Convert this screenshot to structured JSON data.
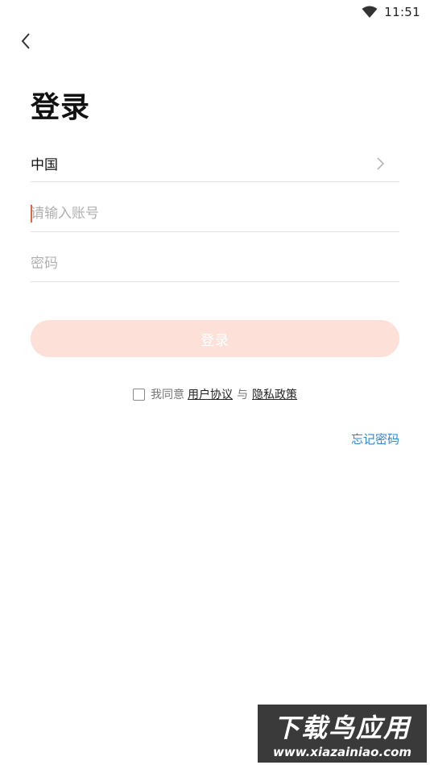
{
  "status_bar": {
    "time": "11:51",
    "wifi_icon": "wifi-icon"
  },
  "nav": {
    "back_icon": "chevron-left-icon"
  },
  "page": {
    "title": "登录"
  },
  "form": {
    "country": {
      "label": "中国",
      "icon": "chevron-right-icon"
    },
    "account": {
      "placeholder": "请输入账号",
      "value": ""
    },
    "password": {
      "placeholder": "密码",
      "value": ""
    },
    "login_label": "登录"
  },
  "agreement": {
    "checked": false,
    "prefix": "我同意",
    "user_agreement": "用户协议",
    "separator": "与",
    "privacy_policy": "隐私政策"
  },
  "forgot_password": "忘记密码",
  "watermark": {
    "title": "下载鸟应用",
    "url": "www.xiazainiao.com"
  },
  "colors": {
    "accent": "#e8643c",
    "button_disabled": "#fde0d7",
    "link": "#2f86d6"
  }
}
